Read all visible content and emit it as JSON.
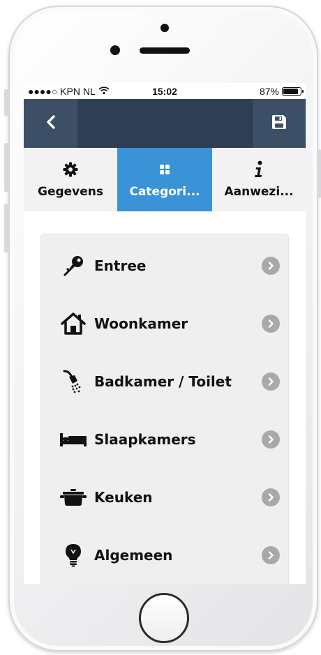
{
  "status_bar": {
    "carrier": "●●●●○ KPN NL",
    "time": "15:02",
    "battery": "87%",
    "battery_level": 0.87
  },
  "navbar": {
    "back_icon": "chevron-left-icon",
    "save_icon": "floppy-disk-icon",
    "colors": {
      "bar": "#2f3e52",
      "button": "#3d4f66"
    }
  },
  "tabs": [
    {
      "label": "Gegevens",
      "icon": "gear-icon",
      "active": false
    },
    {
      "label": "Categori...",
      "icon": "grid-icon",
      "active": true
    },
    {
      "label": "Aanwezi...",
      "icon": "info-icon",
      "active": false
    }
  ],
  "accent_color": "#3a93d6",
  "categories": [
    {
      "label": "Entree",
      "icon": "key-icon"
    },
    {
      "label": "Woonkamer",
      "icon": "house-icon"
    },
    {
      "label": "Badkamer / Toilet",
      "icon": "shower-icon"
    },
    {
      "label": "Slaapkamers",
      "icon": "bed-icon"
    },
    {
      "label": "Keuken",
      "icon": "cooking-pot-icon"
    },
    {
      "label": "Algemeen",
      "icon": "lightbulb-icon"
    }
  ]
}
